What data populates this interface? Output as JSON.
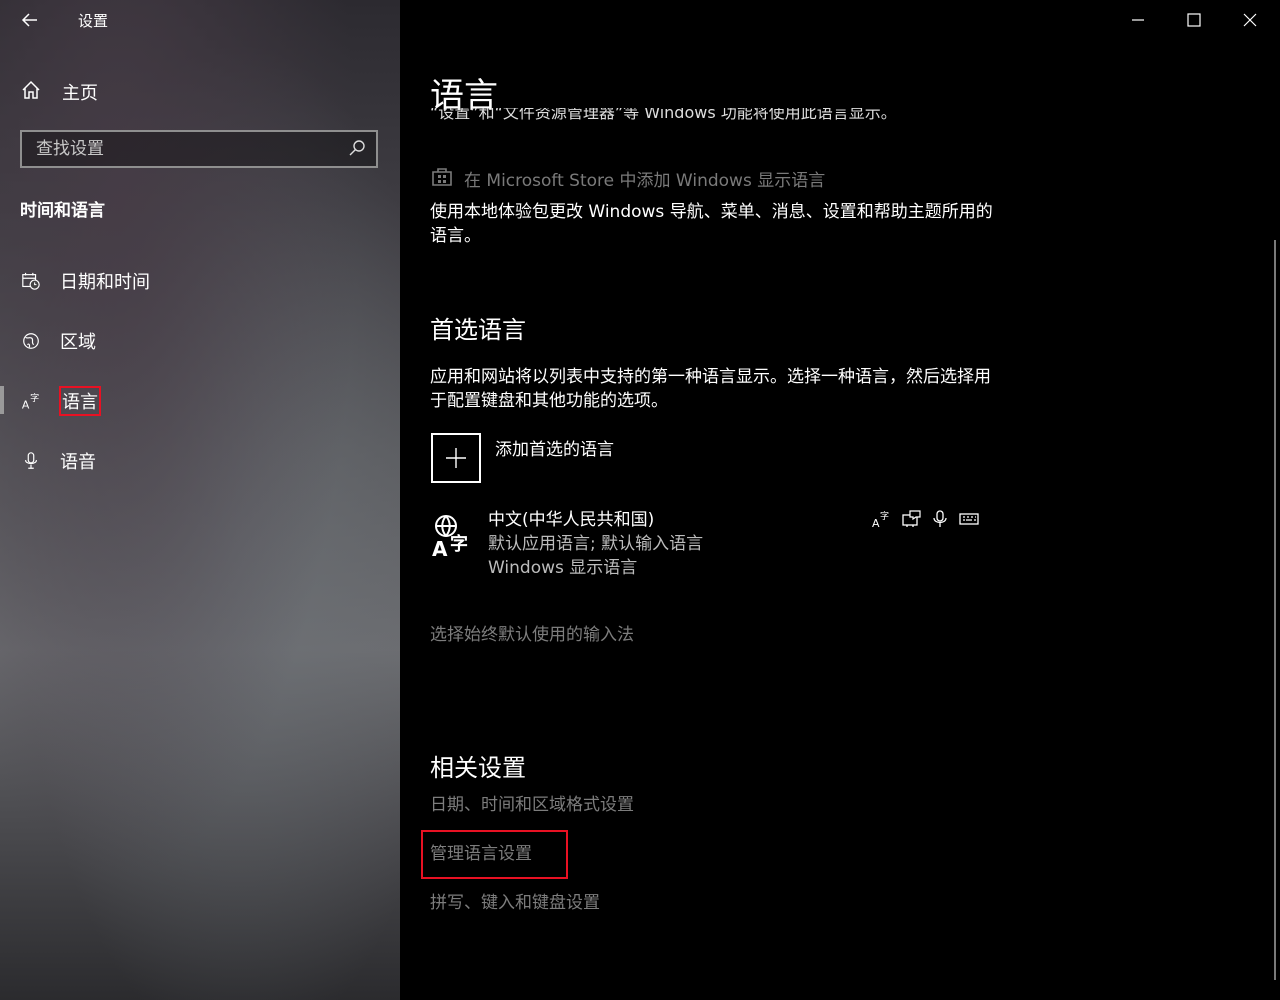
{
  "window": {
    "title": "设置",
    "controls": [
      "minimize-icon",
      "maximize-icon",
      "close-icon"
    ]
  },
  "sidebar": {
    "home_label": "主页",
    "search_placeholder": "查找设置",
    "section_title": "时间和语言",
    "items": [
      {
        "label": "日期和时间",
        "icon": "calendar-clock-icon"
      },
      {
        "label": "区域",
        "icon": "globe-region-icon"
      },
      {
        "label": "语言",
        "icon": "language-icon",
        "selected": true
      },
      {
        "label": "语音",
        "icon": "microphone-icon"
      }
    ]
  },
  "main": {
    "title": "语言",
    "clipped_text": "“设置”和“文件资源管理器”等 Windows 功能将使用此语言显示。",
    "store_link": "在 Microsoft Store 中添加 Windows 显示语言",
    "store_desc": "使用本地体验包更改 Windows 导航、菜单、消息、设置和帮助主题所用的语言。",
    "preferred": {
      "heading": "首选语言",
      "desc": "应用和网站将以列表中支持的第一种语言显示。选择一种语言，然后选择用于配置键盘和其他功能的选项。",
      "add_label": "添加首选的语言",
      "languages": [
        {
          "name": "中文(中华人民共和国)",
          "line2": "默认应用语言; 默认输入语言",
          "line3": "Windows 显示语言",
          "features": [
            "display-language-icon",
            "text-to-speech-icon",
            "speech-recognition-icon",
            "keyboard-icon"
          ]
        }
      ],
      "input_method_link": "选择始终默认使用的输入法"
    },
    "related": {
      "heading": "相关设置",
      "links": [
        "日期、时间和区域格式设置",
        "管理语言设置",
        "拼写、键入和键盘设置"
      ]
    }
  },
  "colors": {
    "highlight_box": "#e81123",
    "disabled_link": "#7d7d7d"
  }
}
